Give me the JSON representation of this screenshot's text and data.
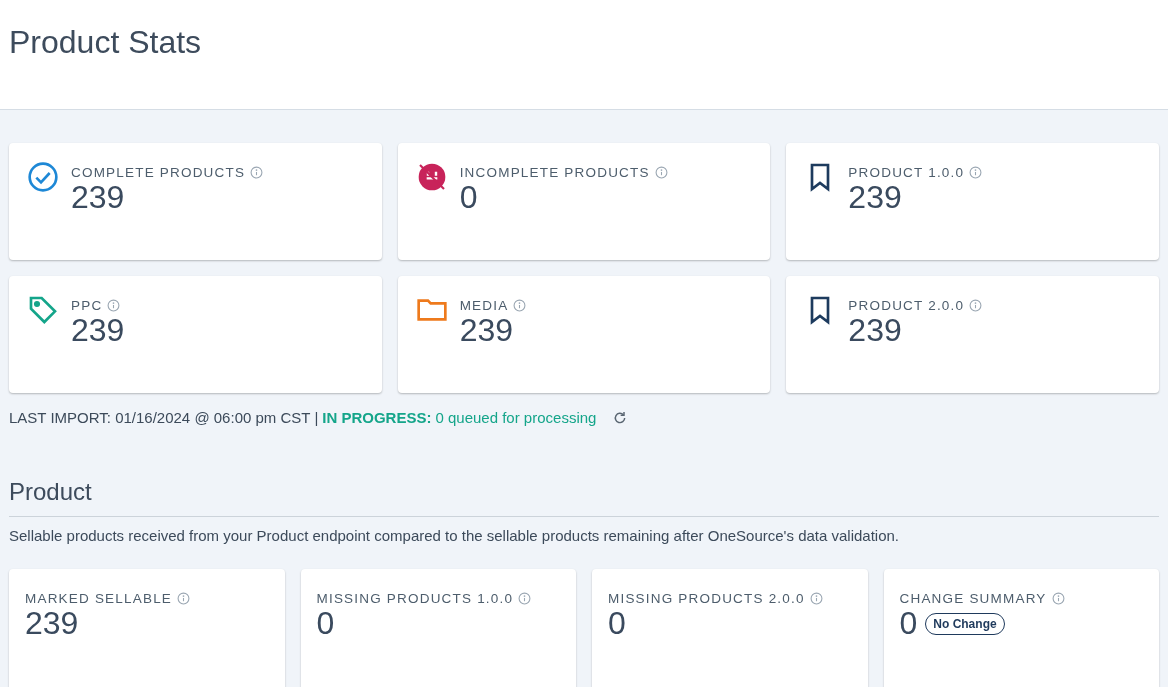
{
  "page_title": "Product Stats",
  "stat_cards": [
    {
      "kind": "check",
      "color": "#1e88d6",
      "label": "COMPLETE PRODUCTS",
      "value": "239"
    },
    {
      "kind": "incomplete",
      "color": "#c8235a",
      "label": "INCOMPLETE PRODUCTS",
      "value": "0"
    },
    {
      "kind": "bookmark",
      "color": "#1d3b5e",
      "label": "PRODUCT 1.0.0",
      "value": "239"
    },
    {
      "kind": "tag",
      "color": "#14a58a",
      "label": "PPC",
      "value": "239"
    },
    {
      "kind": "folder",
      "color": "#ee7a1c",
      "label": "MEDIA",
      "value": "239"
    },
    {
      "kind": "bookmark",
      "color": "#1d3b5e",
      "label": "PRODUCT 2.0.0",
      "value": "239"
    }
  ],
  "import_status": {
    "last_import": "LAST IMPORT: 01/16/2024 @ 06:00 pm CST |",
    "status_label": "IN PROGRESS:",
    "status_text": "0 queued for processing"
  },
  "product_section": {
    "title": "Product",
    "description": "Sellable products received from your Product endpoint compared to the sellable products remaining after OneSource's data validation.",
    "cards": [
      {
        "label": "MARKED SELLABLE",
        "value": "239"
      },
      {
        "label": "MISSING PRODUCTS 1.0.0",
        "value": "0"
      },
      {
        "label": "MISSING PRODUCTS 2.0.0",
        "value": "0"
      },
      {
        "label": "CHANGE SUMMARY",
        "value": "0",
        "badge": "No Change"
      }
    ]
  }
}
